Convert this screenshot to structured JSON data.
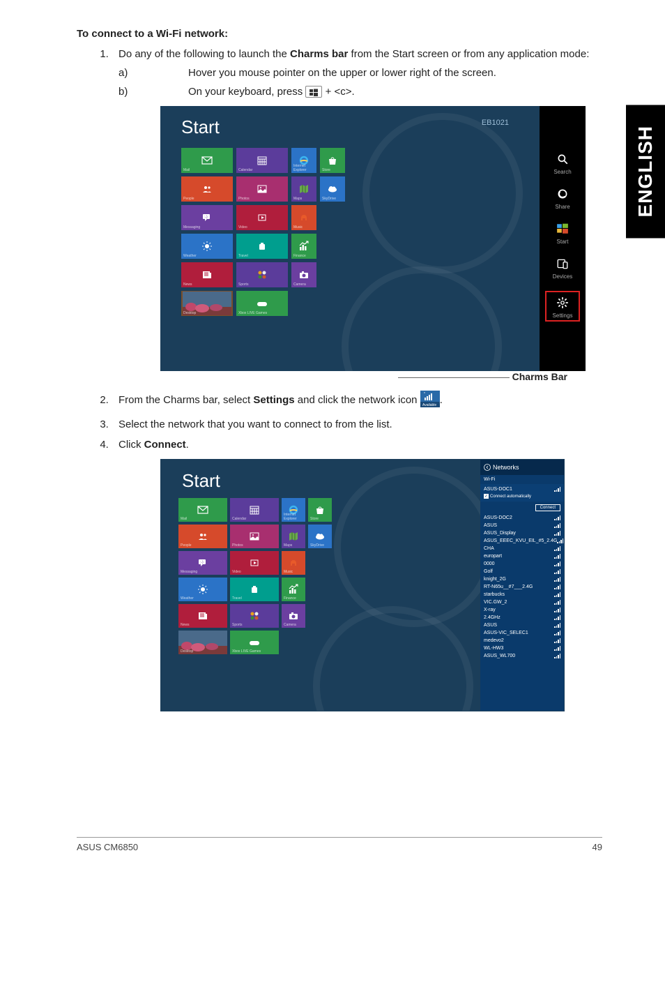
{
  "sidebar_label": "ENGLISH",
  "heading": "To connect to a Wi-Fi network:",
  "steps": {
    "s1": {
      "num": "1.",
      "text_before_bold": "Do any of the following to launch the ",
      "bold": "Charms bar",
      "text_after_bold": " from the Start screen or from any application mode:"
    },
    "s1a": {
      "label": "a)",
      "text": "Hover you mouse pointer on the upper or lower right of the screen."
    },
    "s1b": {
      "label": "b)",
      "text_before": "On your keyboard, press ",
      "text_after": " + <c>."
    },
    "s2": {
      "num": "2.",
      "before": "From the Charms bar, select ",
      "bold": "Settings",
      "after": " and click the network icon ",
      "trailing_period": "."
    },
    "s3": {
      "num": "3.",
      "text": "Select the network that you want to connect to from the list."
    },
    "s4": {
      "num": "4.",
      "before": "Click ",
      "bold": "Connect",
      "after": "."
    }
  },
  "figure1": {
    "start_label": "Start",
    "user": "EB1021",
    "caption": "Charms Bar",
    "tiles": [
      {
        "bg": "#2f9b4b",
        "icon": "mail",
        "label": "Mail",
        "span": 1
      },
      {
        "bg": "#5b3c9b",
        "icon": "calendar",
        "label": "Calendar",
        "span": 1
      },
      {
        "bg": "#2b73c7",
        "icon": "ie",
        "label": "Internet Explorer",
        "span": 0.5
      },
      {
        "bg": "#2f9b4b",
        "icon": "store",
        "label": "Store",
        "span": 0.5
      },
      {
        "bg": "#d64a2b",
        "icon": "people",
        "label": "People",
        "span": 1
      },
      {
        "bg": "#a82f6f",
        "icon": "photos",
        "label": "Photos",
        "span": 1
      },
      {
        "bg": "#5b3c9b",
        "icon": "maps",
        "label": "Maps",
        "span": 0.5
      },
      {
        "bg": "#2b73c7",
        "icon": "skydrive",
        "label": "SkyDrive",
        "span": 0.5
      },
      {
        "bg": "#6b3fa0",
        "icon": "messaging",
        "label": "Messaging",
        "span": 1
      },
      {
        "bg": "#b01e3c",
        "icon": "video",
        "label": "Video",
        "span": 1
      },
      {
        "bg": "#d64a2b",
        "icon": "music",
        "label": "Music",
        "span": 0.5
      },
      {
        "bg": "",
        "icon": "",
        "label": "",
        "span": 0.5
      },
      {
        "bg": "#2b73c7",
        "icon": "weather",
        "label": "Weather",
        "span": 1
      },
      {
        "bg": "#009e8e",
        "icon": "travel",
        "label": "Travel",
        "span": 1
      },
      {
        "bg": "#2f9b4b",
        "icon": "finance",
        "label": "Finance",
        "span": 0.5
      },
      {
        "bg": "",
        "icon": "",
        "label": "",
        "span": 0.5
      },
      {
        "bg": "#b01e3c",
        "icon": "news",
        "label": "News",
        "span": 1
      },
      {
        "bg": "#5b3c9b",
        "icon": "sports",
        "label": "Sports",
        "span": 1
      },
      {
        "bg": "#6b3fa0",
        "icon": "camera",
        "label": "Camera",
        "span": 0.5
      },
      {
        "bg": "",
        "icon": "",
        "label": "",
        "span": 0.5
      },
      {
        "bg": "#7a4f2a",
        "icon": "desktop",
        "label": "Desktop",
        "span": 1,
        "img": true
      },
      {
        "bg": "#2f9b4b",
        "icon": "xbox",
        "label": "Xbox LIVE Games",
        "span": 1
      }
    ],
    "charms": [
      {
        "icon": "search",
        "label": "Search"
      },
      {
        "icon": "share",
        "label": "Share"
      },
      {
        "icon": "start",
        "label": "Start"
      },
      {
        "icon": "devices",
        "label": "Devices"
      },
      {
        "icon": "settings",
        "label": "Settings"
      }
    ]
  },
  "network_icon_badge": "Available",
  "figure2": {
    "start_label": "Start",
    "panel_title": "Networks",
    "section_label": "Wi-Fi",
    "selected_network": "ASUS-DOC1",
    "connect_auto": "Connect automatically",
    "connect_btn": "Connect",
    "networks": [
      "ASUS-DOC2",
      "ASUS",
      "ASUS_Display",
      "ASUS_EEEC_KVU_EIL_#5_2.4G",
      "CHA",
      "europart",
      "0000",
      "Golf",
      "knight_2G",
      "RT-N65u__#7___2.4G",
      "starbucks",
      "VIC.GW_2",
      "X-ray",
      "2.4GHz",
      "ASUS",
      "ASUS-VIC_SELEC1",
      "medevo2",
      "WL-HW3",
      "ASUS_WL700"
    ]
  },
  "footer": {
    "left": "ASUS CM6850",
    "right": "49"
  }
}
